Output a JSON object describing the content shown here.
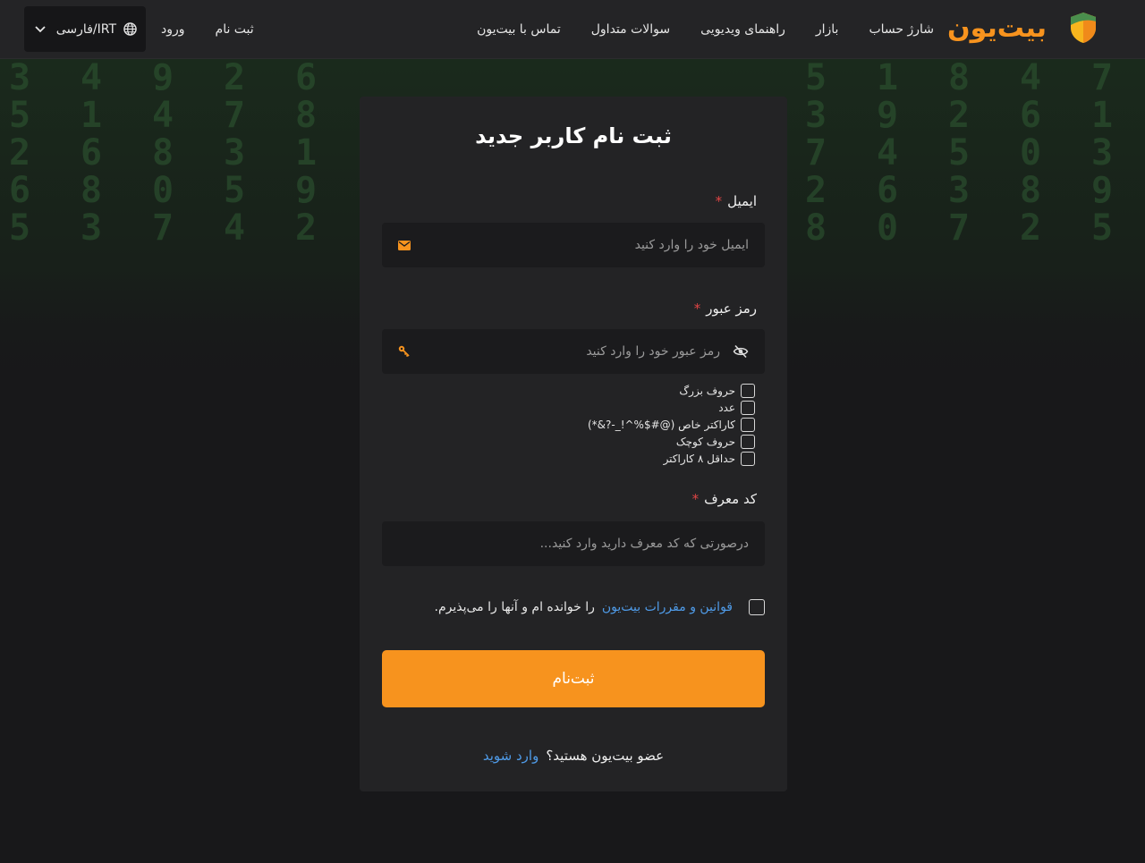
{
  "header": {
    "brand_name": "بیت‌یون",
    "nav": [
      "شارژ حساب",
      "بازار",
      "راهنمای ویدیویی",
      "سوالات متداول",
      "تماس با بیت‌یون"
    ],
    "signup_link": "ثبت نام",
    "login_link": "ورود",
    "language_label": "فارسی/IRT"
  },
  "form": {
    "title": "ثبت نام کاربر جدید",
    "email": {
      "label": "ایمیل",
      "required_mark": "*",
      "placeholder": "ایمیل خود را وارد کنید",
      "value": ""
    },
    "password": {
      "label": "رمز عبور",
      "required_mark": "*",
      "placeholder": "رمز عبور خود را وارد کنید",
      "value": ""
    },
    "password_rules": [
      "حروف بزرگ",
      "عدد",
      "کاراکتر خاص (@#$%^!_-?&*)",
      "حروف کوچک",
      "حداقل ۸ کاراکتر"
    ],
    "referral": {
      "label": "کد معرف",
      "required_mark": "*",
      "placeholder": "درصورتی که کد معرف دارید وارد کنید...",
      "value": ""
    },
    "terms_link": "قوانین و مقررات بیت‌یون",
    "terms_text": "را خوانده ام و آنها را می‌پذیرم.",
    "submit_label": "ثبت‌نام",
    "member_text": "عضو بیت‌یون هستید؟",
    "login_link": "وارد شوید"
  },
  "colors": {
    "accent": "#f7931e",
    "link": "#4f9be8",
    "required": "#e04545"
  },
  "icons": {
    "brand": "shield-icon",
    "language": "globe-icon",
    "dropdown": "chevron-down-icon",
    "email": "envelope-icon",
    "password": "key-icon",
    "visibility": "eye-off-icon"
  }
}
